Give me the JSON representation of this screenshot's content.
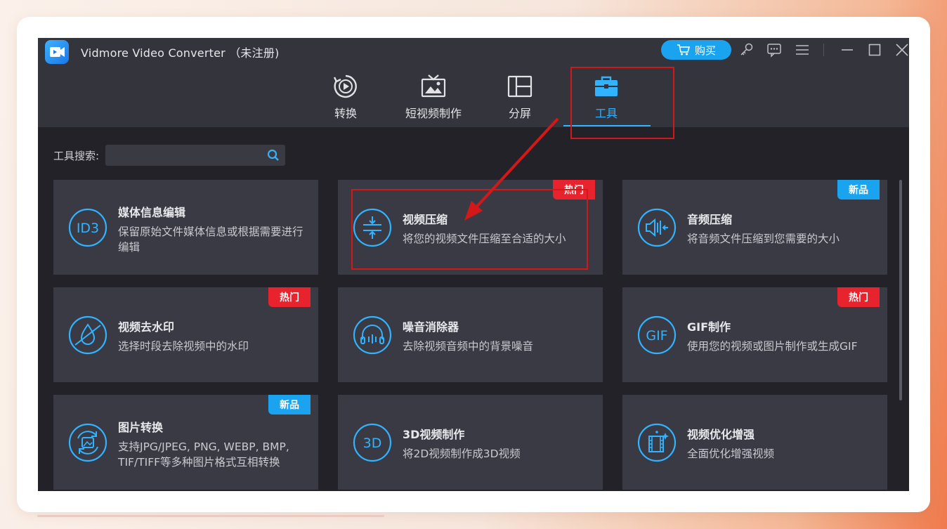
{
  "app": {
    "title": "Vidmore Video Converter （未注册)",
    "buy_label": "购买"
  },
  "nav": {
    "tabs": [
      {
        "label": "转换",
        "icon": "convert-icon"
      },
      {
        "label": "短视频制作",
        "icon": "mv-icon"
      },
      {
        "label": "分屏",
        "icon": "collage-icon"
      },
      {
        "label": "工具",
        "icon": "toolbox-icon",
        "active": true
      }
    ]
  },
  "search": {
    "label": "工具搜索:",
    "placeholder": "",
    "value": ""
  },
  "tools": [
    {
      "name": "媒体信息编辑",
      "desc": "保留原始文件媒体信息或根据需要进行编辑",
      "icon_text": "ID3",
      "badge": ""
    },
    {
      "name": "视频压缩",
      "desc": "将您的视频文件压缩至合适的大小",
      "icon_text": "",
      "badge": "热门"
    },
    {
      "name": "音频压缩",
      "desc": "将音频文件压缩到您需要的大小",
      "icon_text": "",
      "badge": "新品"
    },
    {
      "name": "视频去水印",
      "desc": "选择时段去除视频中的水印",
      "icon_text": "",
      "badge": "热门"
    },
    {
      "name": "噪音消除器",
      "desc": "去除视频音频中的背景噪音",
      "icon_text": "",
      "badge": ""
    },
    {
      "name": "GIF制作",
      "desc": "使用您的视频或图片制作或生成GIF",
      "icon_text": "GIF",
      "badge": "热门"
    },
    {
      "name": "图片转换",
      "desc": "支持JPG/JPEG, PNG, WEBP, BMP, TIF/TIFF等多种图片格式互相转换",
      "icon_text": "",
      "badge": "新品"
    },
    {
      "name": "3D视频制作",
      "desc": "将2D视频制作成3D视频",
      "icon_text": "3D",
      "badge": ""
    },
    {
      "name": "视频优化增强",
      "desc": "全面优化增强视频",
      "icon_text": "",
      "badge": ""
    }
  ],
  "colors": {
    "accent": "#31b3ff",
    "hot_badge": "#e8232e",
    "new_badge": "#1aa3ef",
    "annotation_red": "#d21818"
  }
}
